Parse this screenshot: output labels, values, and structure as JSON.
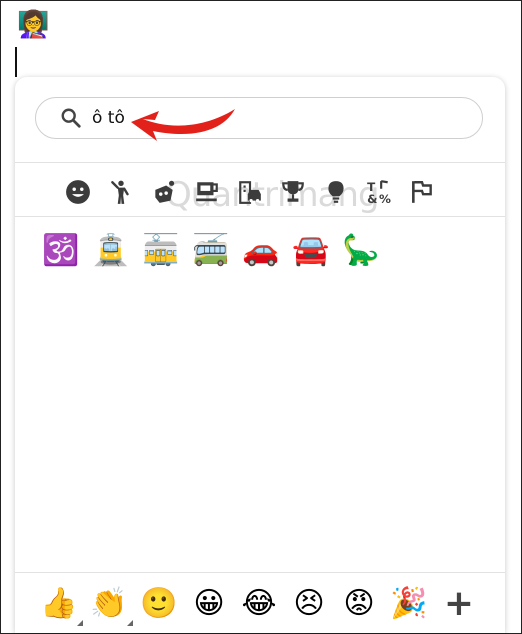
{
  "header": {
    "avatar_emoji": "👩‍🏫"
  },
  "search": {
    "value": "ô tô",
    "icon": "search-icon"
  },
  "watermark": "Quantrimang",
  "categories": [
    {
      "name": "smileys",
      "icon": "smiley-face-icon"
    },
    {
      "name": "people",
      "icon": "person-icon"
    },
    {
      "name": "animals",
      "icon": "paw-icon"
    },
    {
      "name": "food",
      "icon": "coffee-cup-icon"
    },
    {
      "name": "travel",
      "icon": "buildings-car-icon"
    },
    {
      "name": "activities",
      "icon": "trophy-icon"
    },
    {
      "name": "objects",
      "icon": "lightbulb-icon"
    },
    {
      "name": "symbols",
      "icon": "symbols-icon"
    },
    {
      "name": "flags",
      "icon": "flag-icon"
    }
  ],
  "results": [
    "🕉️",
    "🚊",
    "🚋",
    "🚎",
    "🚗",
    "🚘",
    "🦕"
  ],
  "bottom_bar": [
    "👍",
    "👏",
    "🙂",
    "😀",
    "😂",
    "😣",
    "😡",
    "🎉"
  ],
  "bottom_plus": "+",
  "colors": {
    "arrow": "#e3211b",
    "icon_gray": "#3c3c3c",
    "border": "#cfcfcf"
  }
}
